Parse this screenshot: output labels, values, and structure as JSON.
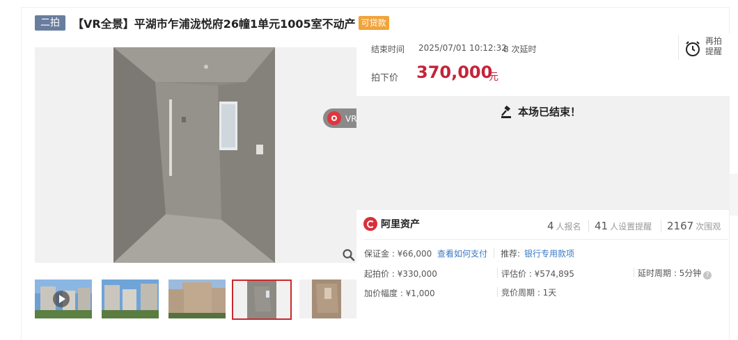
{
  "title": {
    "round_badge": "二拍",
    "text": "【VR全景】平湖市乍浦泷悦府26幢1单元1005室不动产",
    "loan_badge": "可贷款"
  },
  "gallery": {
    "vr_label": "VR全景",
    "vr_arrow": "›",
    "thumbnails": [
      {
        "icon": "play-icon",
        "active": false
      },
      {
        "active": false
      },
      {
        "active": false
      },
      {
        "active": true
      },
      {
        "active": false
      }
    ]
  },
  "auction": {
    "end_label": "结束时间",
    "end_time": "2025/07/01 10:12:32",
    "delay_count": "8",
    "delay_suffix": "次延时",
    "remind_label": "再拍\n提醒",
    "deal_label": "拍下价",
    "deal_price": "370,000",
    "deal_unit": "元",
    "ended_text": "本场已结束！"
  },
  "stats": {
    "platform": "阿里资产",
    "signups": "4",
    "signups_label": "人报名",
    "reminders": "41",
    "reminders_label": "人设置提醒",
    "views": "2167",
    "views_label": "次围观"
  },
  "details": {
    "deposit": "保证金 : ¥66,000",
    "deposit_link": "查看如何支付",
    "recommend_label": "推荐:",
    "recommend_link": "银行专用款项",
    "start_price": "起拍价 : ¥330,000",
    "appraisal": "评估价 : ¥574,895",
    "delay_period": "延时周期 : 5分钟",
    "increment": "加价幅度 : ¥1,000",
    "bid_period": "竞价周期 : 1天"
  },
  "colors": {
    "accent_red": "#c5243a",
    "badge_blue": "#697d9e",
    "loan_orange": "#f2a33a",
    "link_blue": "#3a78c4"
  }
}
